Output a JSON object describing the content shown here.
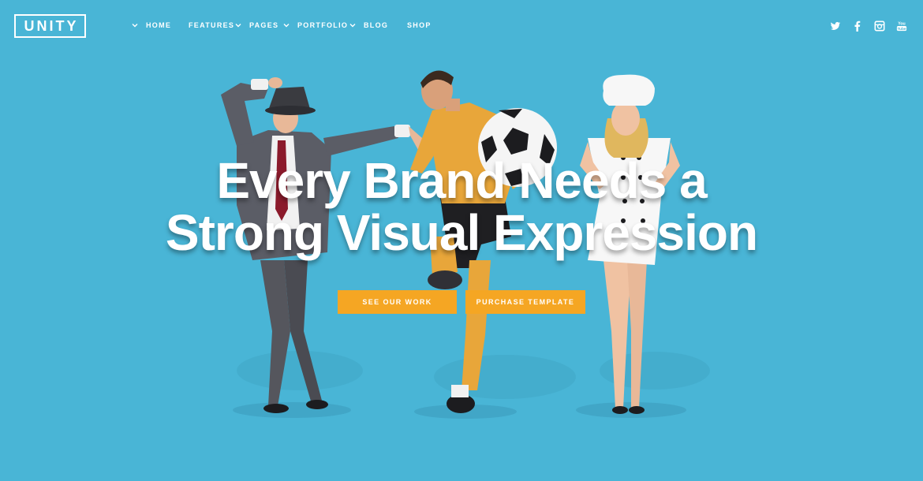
{
  "brand": {
    "logo": "UNITY"
  },
  "nav": {
    "items": [
      {
        "label": "HOME",
        "has_dropdown": true
      },
      {
        "label": "FEATURES",
        "has_dropdown": false
      },
      {
        "label": "PAGES",
        "has_dropdown": true
      },
      {
        "label": "PORTFOLIO",
        "has_dropdown": true
      },
      {
        "label": "BLOG",
        "has_dropdown": true
      },
      {
        "label": "SHOP",
        "has_dropdown": false
      }
    ]
  },
  "social": [
    "twitter-icon",
    "facebook-icon",
    "instagram-icon",
    "youtube-icon"
  ],
  "hero": {
    "headline_line1": "Every Brand Needs a",
    "headline_line2": "Strong Visual Expression",
    "primary_cta": "SEE OUR WORK",
    "secondary_cta": "PURCHASE TEMPLATE"
  },
  "colors": {
    "background": "#49b5d6",
    "button": "#f5a623",
    "text": "#ffffff"
  }
}
